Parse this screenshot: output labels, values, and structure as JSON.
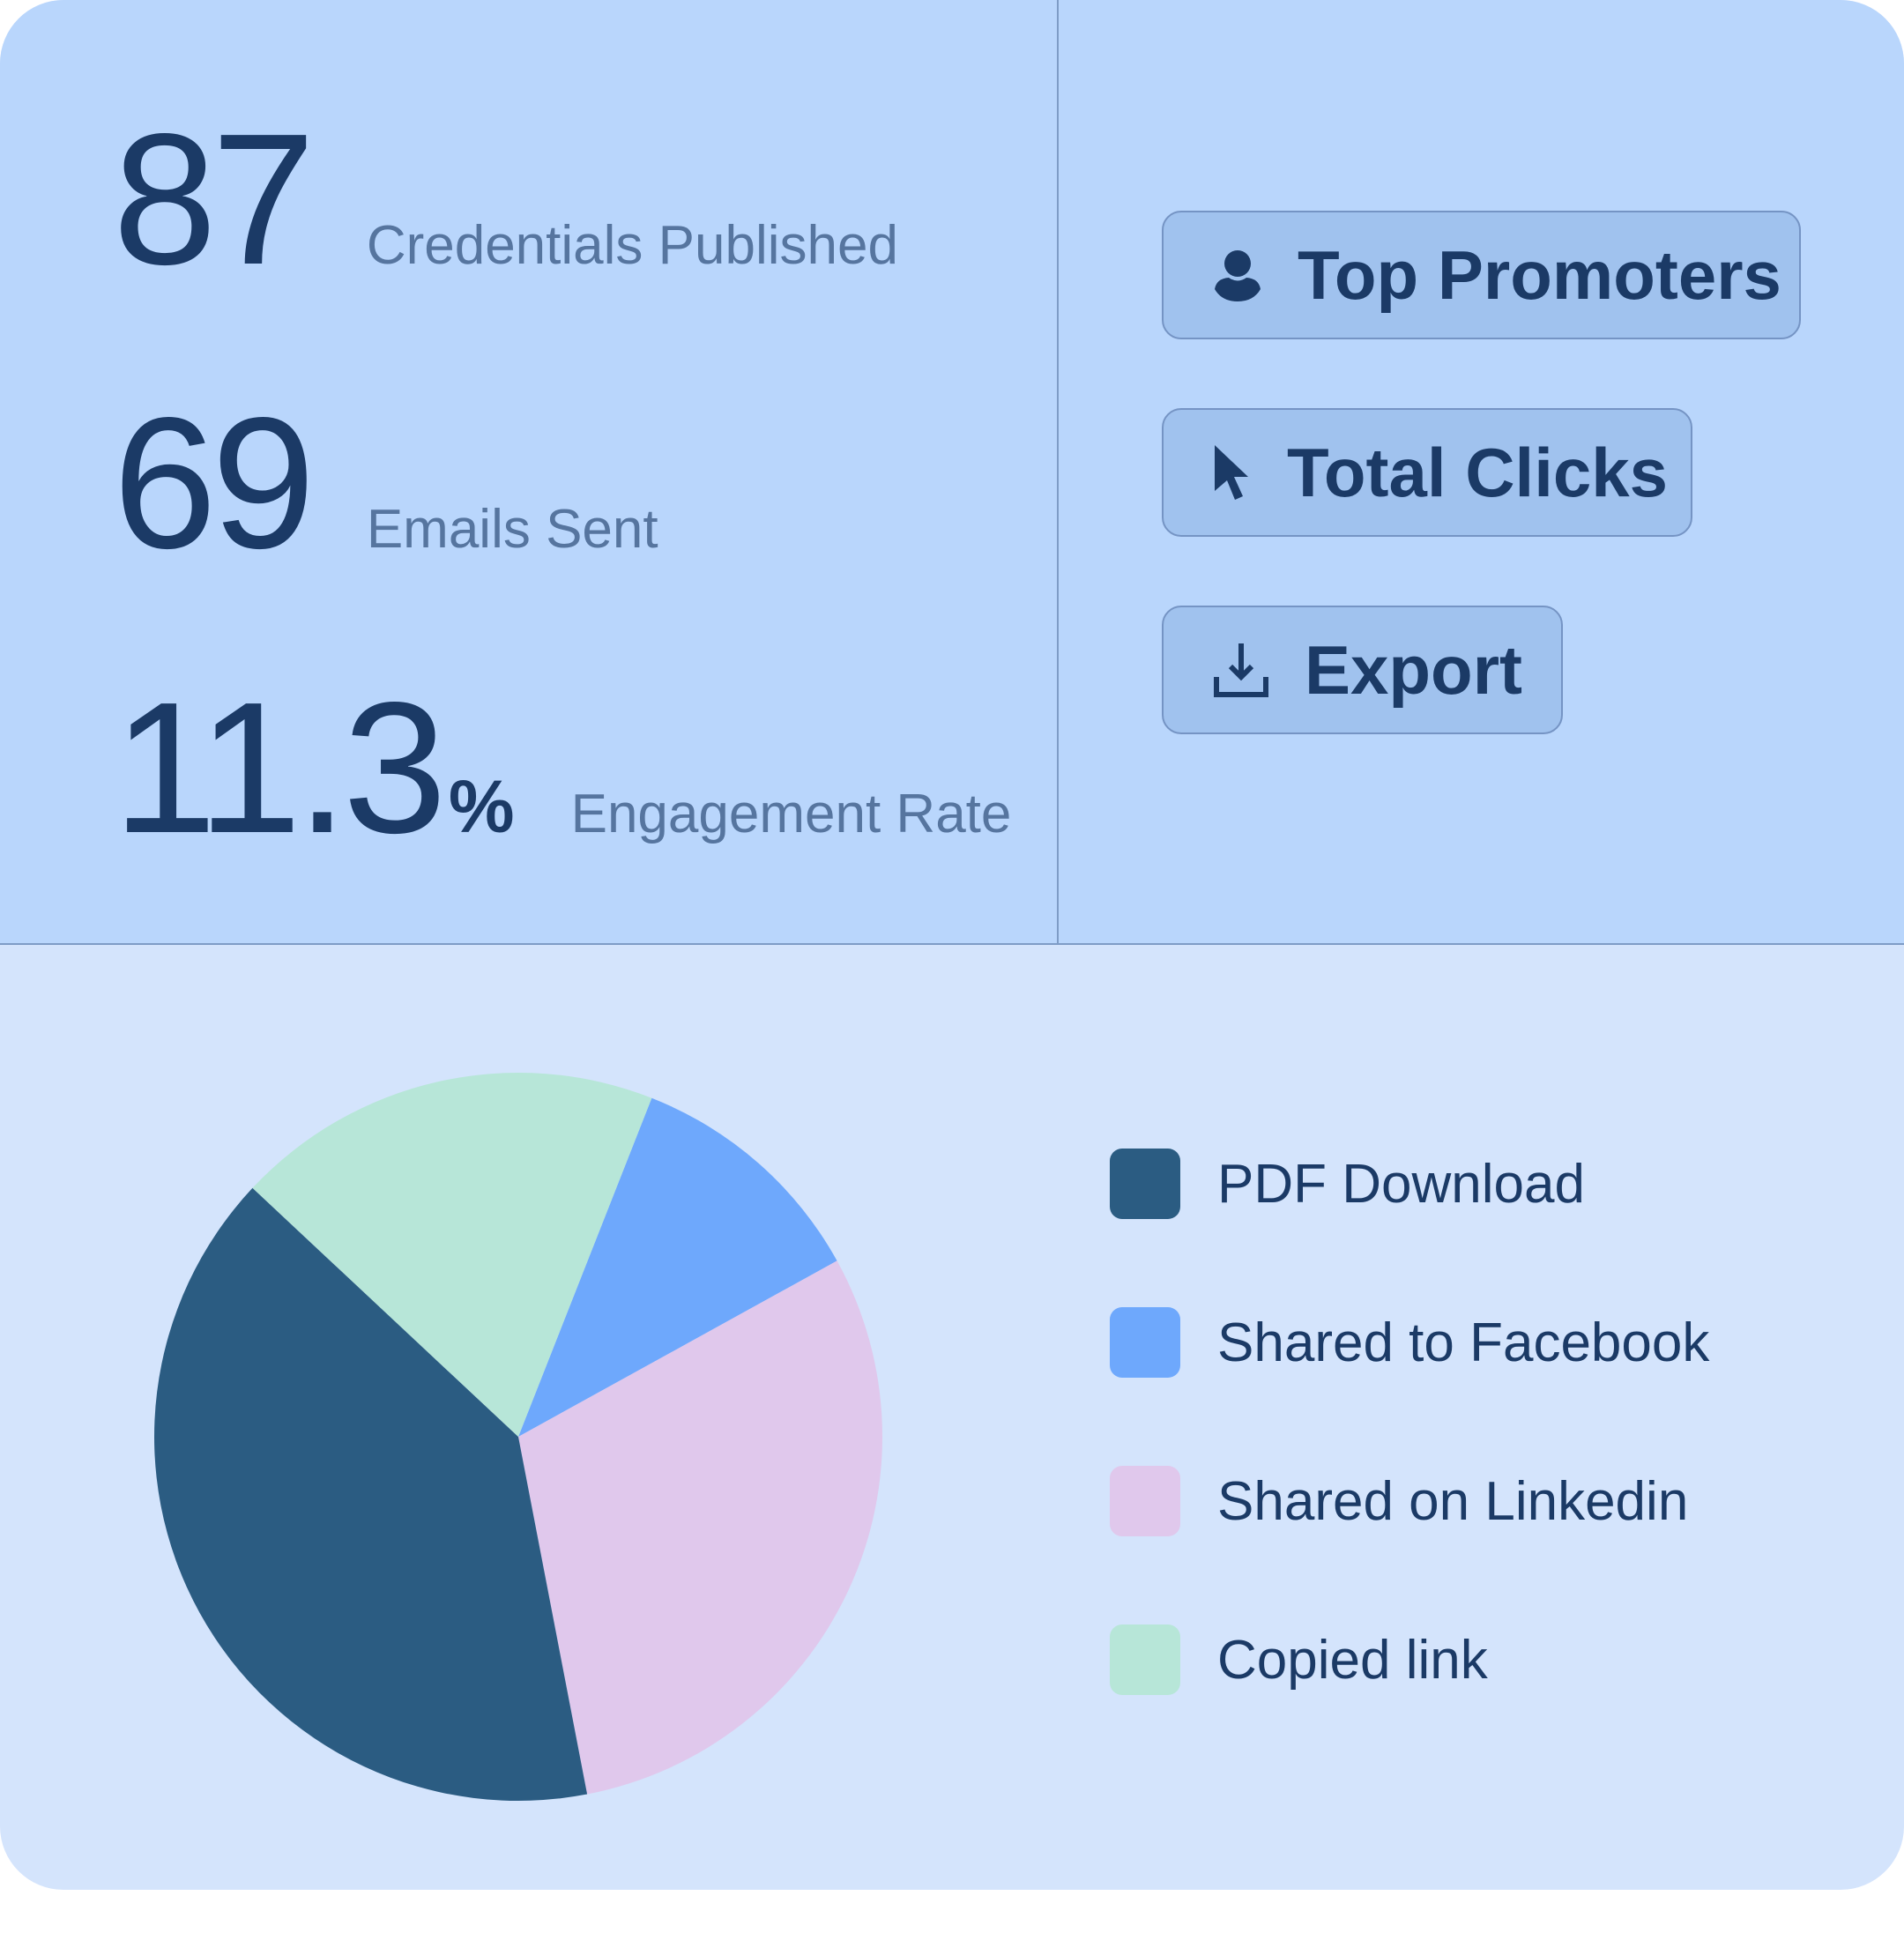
{
  "stats": [
    {
      "value": "87",
      "label": "Credentials Published"
    },
    {
      "value": "69",
      "label": "Emails Sent"
    },
    {
      "value": "11.3",
      "unit": "%",
      "label": "Engagement Rate"
    }
  ],
  "buttons": [
    {
      "label": "Top Promoters",
      "icon": "user-icon"
    },
    {
      "label": "Total Clicks",
      "icon": "cursor-icon"
    },
    {
      "label": "Export",
      "icon": "download-icon"
    }
  ],
  "chart_data": {
    "type": "pie",
    "title": "",
    "slices": [
      {
        "label": "PDF Download",
        "value": 40,
        "color": "#2b5c82"
      },
      {
        "label": "Shared to Facebook",
        "value": 11,
        "color": "#6ea8fc"
      },
      {
        "label": "Shared on Linkedin",
        "value": 30,
        "color": "#e0c8ec"
      },
      {
        "label": "Copied link",
        "value": 19,
        "color": "#b7e6d8"
      }
    ],
    "draw_order": [
      "Shared to Facebook",
      "Shared on Linkedin",
      "PDF Download",
      "Copied link"
    ],
    "start_angle_deg": 21.5,
    "legend_position": "right"
  }
}
